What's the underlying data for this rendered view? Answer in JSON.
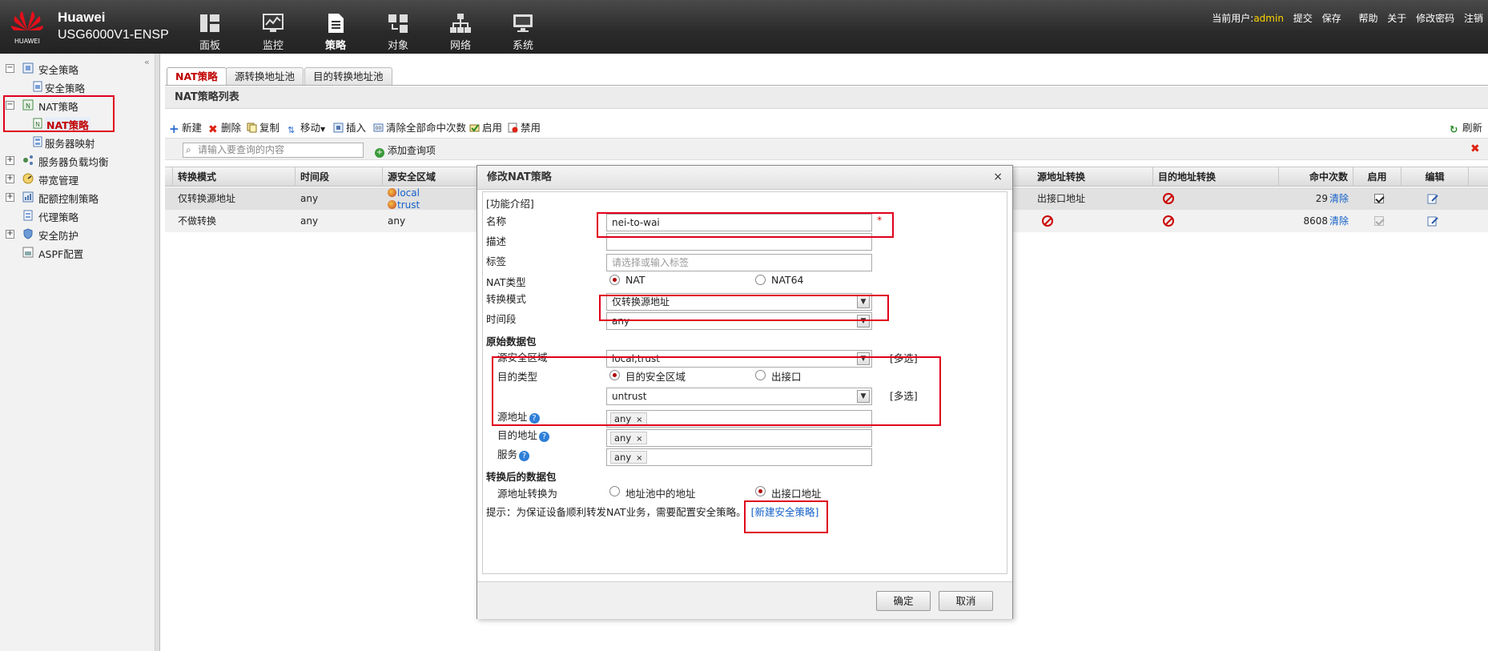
{
  "header": {
    "brand_name": "Huawei",
    "model": "USG6000V1-ENSP",
    "logo_text": "HUAWEI",
    "nav": [
      {
        "label": "面板",
        "icon": "dashboard-icon"
      },
      {
        "label": "监控",
        "icon": "monitor-icon"
      },
      {
        "label": "策略",
        "icon": "policy-icon",
        "active": true
      },
      {
        "label": "对象",
        "icon": "object-icon"
      },
      {
        "label": "网络",
        "icon": "network-icon"
      },
      {
        "label": "系统",
        "icon": "system-icon"
      }
    ],
    "current_user_label": "当前用户:",
    "current_user": "admin",
    "links": [
      "提交",
      "保存",
      "帮助",
      "关于",
      "修改密码",
      "注销"
    ]
  },
  "sidebar": {
    "collapse_glyph": "«",
    "items": [
      {
        "label": "安全策略",
        "expander": "−"
      },
      {
        "label": "安全策略"
      },
      {
        "label": "NAT策略",
        "expander": "−"
      },
      {
        "label": "NAT策略",
        "selected": true
      },
      {
        "label": "服务器映射"
      },
      {
        "label": "服务器负载均衡",
        "expander": "+"
      },
      {
        "label": "带宽管理",
        "expander": "+"
      },
      {
        "label": "配额控制策略",
        "expander": "+"
      },
      {
        "label": "代理策略"
      },
      {
        "label": "安全防护",
        "expander": "+"
      },
      {
        "label": "ASPF配置"
      }
    ]
  },
  "tabs": [
    "NAT策略",
    "源转换地址池",
    "目的转换地址池"
  ],
  "list_title": "NAT策略列表",
  "toolbar": {
    "new": "新建",
    "delete": "删除",
    "copy": "复制",
    "move": "移动",
    "insert": "插入",
    "clear_hits": "清除全部命中次数",
    "enable": "启用",
    "disable": "禁用",
    "refresh": "刷新"
  },
  "search": {
    "placeholder": "请输入要查询的内容",
    "add_query": "添加查询项"
  },
  "table": {
    "headers": {
      "mode": "转换模式",
      "time": "时间段",
      "src_zone": "源安全区域",
      "src_trans": "源地址转换",
      "dst_trans": "目的地址转换",
      "hits": "命中次数",
      "enabled": "启用",
      "edit": "编辑"
    },
    "rows": [
      {
        "mode": "仅转换源地址",
        "time": "any",
        "src_zone_1": "local",
        "src_zone_2": "trust",
        "src_trans": "出接口地址",
        "hits": "29",
        "clear": "清除",
        "enabled": true
      },
      {
        "mode": "不做转换",
        "time": "any",
        "src_zone": "any",
        "hits": "8608",
        "clear": "清除",
        "enabled": true
      }
    ]
  },
  "dialog": {
    "title": "修改NAT策略",
    "close_glyph": "×",
    "intro_link": "[功能介绍]",
    "name_label": "名称",
    "name_value": "nei-to-wai",
    "required_mark": "*",
    "desc_label": "描述",
    "tag_label": "标签",
    "tag_placeholder": "请选择或输入标签",
    "nat_type_label": "NAT类型",
    "nat_type_options": [
      "NAT",
      "NAT64"
    ],
    "mode_label": "转换模式",
    "mode_value": "仅转换源地址",
    "time_label": "时间段",
    "time_value": "any",
    "orig_section": "原始数据包",
    "src_zone_label": "源安全区域",
    "src_zone_value": "local,trust",
    "multi_select": "[多选]",
    "dst_type_label": "目的类型",
    "dst_type_options": [
      "目的安全区域",
      "出接口"
    ],
    "dst_zone_value": "untrust",
    "src_addr_label": "源地址",
    "dst_addr_label": "目的地址",
    "service_label": "服务",
    "any_tag": "any",
    "tag_remove": "×",
    "help_glyph": "?",
    "trans_section": "转换后的数据包",
    "src_trans_label": "源地址转换为",
    "src_trans_options": [
      "地址池中的地址",
      "出接口地址"
    ],
    "hint_text": "提示：为保证设备顺利转发NAT业务，需要配置安全策略。",
    "hint_link": "[新建安全策略]",
    "ok": "确定",
    "cancel": "取消"
  },
  "colors": {
    "header_bg": "#2f2f2f",
    "brand_red": "#c7000b",
    "annotation_red": "#e0001b",
    "link_blue": "#1460c8"
  }
}
